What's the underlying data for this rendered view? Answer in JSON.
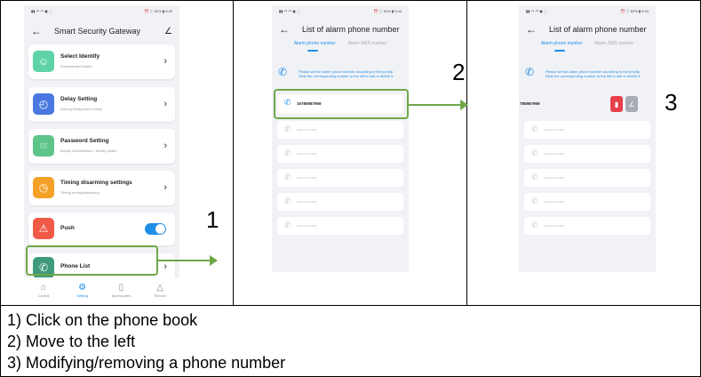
{
  "screen1": {
    "status_left": "▮▮ ⁴ᴳ ⁴ᴳ ▣ ⬚",
    "status_right": "⏰ ⓘ 62% ▮ 9:43",
    "title": "Smart Security Gateway",
    "items": [
      {
        "title": "Select Identify",
        "sub": "Administrator/Visitor",
        "color": "#5fd3a7",
        "icon": "person-icon"
      },
      {
        "title": "Delay Setting",
        "sub": "Arming Delay/Alarm Delay",
        "color": "#4a78e0",
        "icon": "clock-icon"
      },
      {
        "title": "Password Setting",
        "sub": "Modify Administrator / Modify Visitor",
        "color": "#5dc48a",
        "icon": "keypad-icon"
      },
      {
        "title": "Timing disarming settings",
        "sub": "Timing arming/disarming",
        "color": "#f5a128",
        "icon": "timer-icon"
      },
      {
        "title": "Push",
        "sub": "",
        "color": "#f05a46",
        "icon": "warning-icon"
      },
      {
        "title": "Phone List",
        "sub": "",
        "color": "#3f9a7c",
        "icon": "phone-book-icon"
      }
    ],
    "tabs": [
      "Control",
      "Setting",
      "Accessories",
      "Record"
    ]
  },
  "screen2": {
    "status_left": "▮▮ ⁴ᴳ ⁴ᴳ ▣ ⬚",
    "status_right": "⏰ ⓘ 62% ▮ 9:44",
    "title": "List of alarm phone number",
    "tab_a": "Alarm phone number",
    "tab_b": "Alarm SMS number",
    "notice": "Please set the alarm phone number according to the priority. Slide the corresponding number to the left to edit or delete it.",
    "first_number": "16785987969",
    "placeholder": "Input number"
  },
  "screen3": {
    "status_left": "▮▮ ⁴ᴳ ⁴ᴳ ▣ ⬚",
    "status_right": "⏰ ⓘ 62% ▮ 9:44",
    "title": "List of alarm phone number",
    "tab_a": "Alarm phone number",
    "tab_b": "Alarm SMS number",
    "notice": "Please set the alarm phone number according to the priority. Slide the corresponding number to the left to edit or delete it.",
    "first_number": "785987969",
    "placeholder": "Input number"
  },
  "labels": {
    "n1": "1",
    "n2": "2",
    "n3": "3"
  },
  "steps": [
    "1) Click on the phone book",
    "2) Move to the left",
    "3) Modifying/removing a phone number"
  ]
}
